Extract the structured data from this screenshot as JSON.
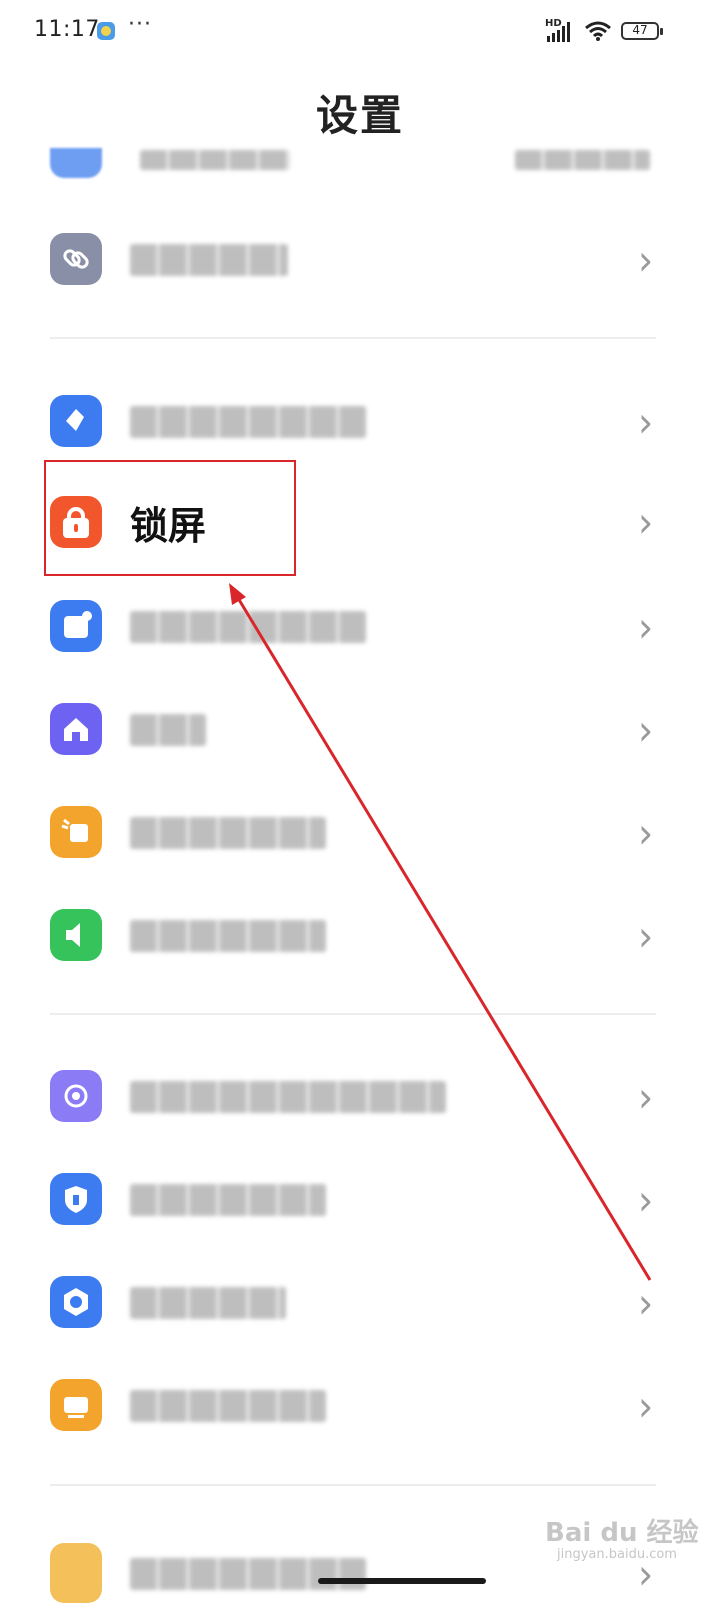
{
  "status_bar": {
    "time": "11:17",
    "more": "···",
    "network": "HD",
    "battery": "47"
  },
  "header": {
    "title": "设置"
  },
  "highlighted_item": {
    "label": "锁屏"
  },
  "watermark": {
    "text": "Bai du 经验",
    "sub": "jingyan.baidu.com"
  },
  "icons": {
    "link": "link-icon",
    "theme": "theme-icon",
    "lock": "lock-icon",
    "notification": "notification-icon",
    "home": "home-icon",
    "display": "display-icon",
    "sound": "sound-icon",
    "fingerprint": "fingerprint-icon",
    "privacy": "shield-icon",
    "app_settings": "app-settings-icon",
    "battery": "battery-icon",
    "extra": "extra-icon"
  },
  "colors": {
    "lock": "#f2562c",
    "link": "#8a8fa8",
    "theme": "#3d7cf0",
    "notification": "#3d7cf0",
    "home": "#6e62f2",
    "display": "#f3a42c",
    "sound": "#36c35b",
    "fingerprint": "#8b7cf5",
    "privacy": "#3d7cf0",
    "app_settings": "#3d7cf0",
    "battery": "#f3a42c",
    "annotation": "#d9262b"
  }
}
